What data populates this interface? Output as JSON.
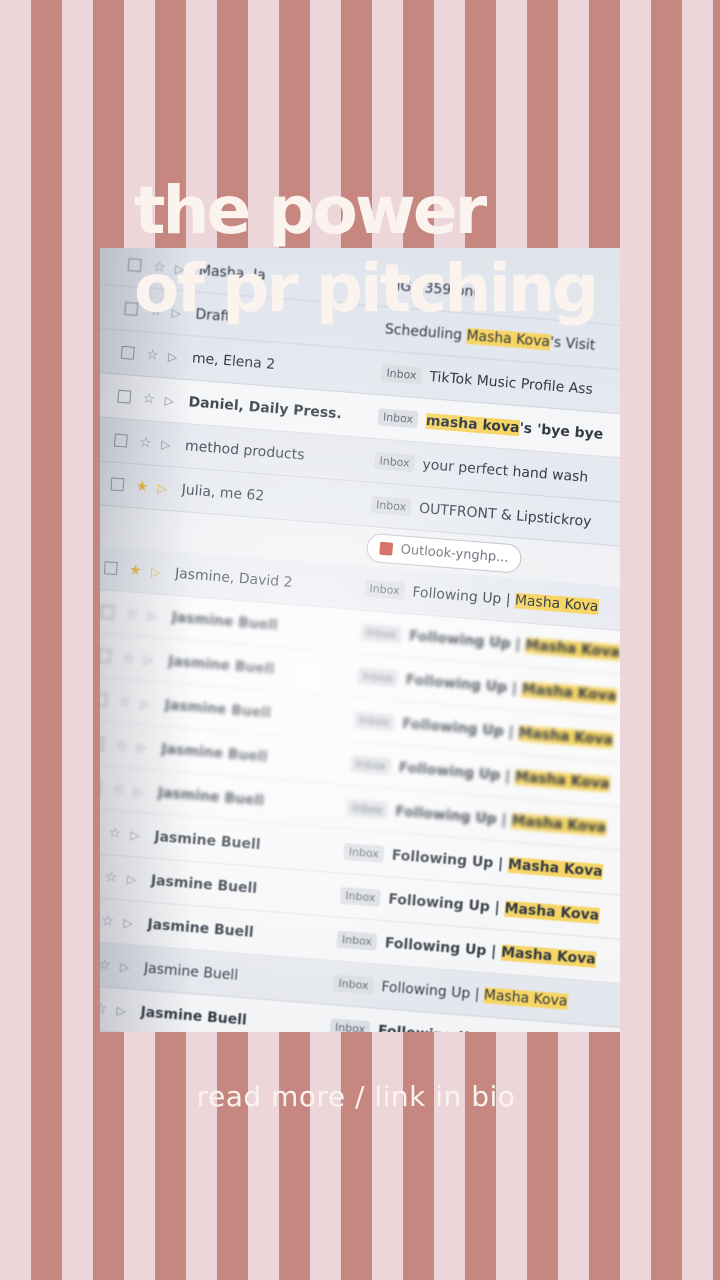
{
  "title": {
    "line1": "the power",
    "line2": "of pr pitching"
  },
  "footer_text": "read more / link in bio",
  "colors": {
    "stripe_light": "#ecd6d9",
    "stripe_dark": "#c58780",
    "title_text": "#fbf3ee",
    "highlight": "#f6d565"
  },
  "inbox": {
    "rows": [
      {
        "sender": "Masha, Ja",
        "tag": "",
        "subject": "MG 8359.png",
        "style": "read"
      },
      {
        "sender": "Draft",
        "tag": "",
        "subject_pre": "Scheduling ",
        "subject_hl": "Masha Kova",
        "subject_post": "'s Visit",
        "style": "read"
      },
      {
        "sender": "me, Elena 2",
        "tag": "Inbox",
        "subject": "TikTok Music Profile Ass",
        "style": "read"
      },
      {
        "sender": "Daniel, Daily Press.",
        "tag": "Inbox",
        "subject_hl": "masha kova",
        "subject_post": "'s 'bye bye",
        "style": "unread"
      },
      {
        "sender": "method products",
        "tag": "Inbox",
        "subject": "your perfect hand wash",
        "style": "read"
      },
      {
        "sender": "Julia, me 62",
        "tag": "Inbox",
        "subject": "OUTFRONT & Lipstickroy",
        "style": "read",
        "starred": true
      }
    ],
    "attachment_chip": "Outlook-ynghp...",
    "rows2": [
      {
        "sender": "Jasmine, David 2",
        "tag": "Inbox",
        "subject_pre": "Following Up | ",
        "subject_hl": "Masha Kova",
        "style": "read",
        "starred": true
      },
      {
        "sender": "Jasmine Buell",
        "tag": "Inbox",
        "subject_pre": "Following Up | ",
        "subject_hl": "Masha Kova",
        "style": "unread"
      },
      {
        "sender": "Jasmine Buell",
        "tag": "Inbox",
        "subject_pre": "Following Up | ",
        "subject_hl": "Masha Kova",
        "style": "unread"
      },
      {
        "sender": "Jasmine Buell",
        "tag": "Inbox",
        "subject_pre": "Following Up | ",
        "subject_hl": "Masha Kova",
        "style": "unread"
      },
      {
        "sender": "Jasmine Buell",
        "tag": "Inbox",
        "subject_pre": "Following Up | ",
        "subject_hl": "Masha Kova",
        "style": "unread"
      },
      {
        "sender": "Jasmine Buell",
        "tag": "Inbox",
        "subject_pre": "Following Up | ",
        "subject_hl": "Masha Kova",
        "style": "unread"
      },
      {
        "sender": "Jasmine Buell",
        "tag": "Inbox",
        "subject_pre": "Following Up | ",
        "subject_hl": "Masha Kova",
        "style": "unread"
      },
      {
        "sender": "Jasmine Buell",
        "tag": "Inbox",
        "subject_pre": "Following Up | ",
        "subject_hl": "Masha Kova",
        "style": "unread"
      },
      {
        "sender": "Jasmine Buell",
        "tag": "Inbox",
        "subject_pre": "Following Up | ",
        "subject_hl": "Masha Kova",
        "style": "unread"
      },
      {
        "sender": "Jasmine Buell",
        "tag": "Inbox",
        "subject_pre": "Following Up | ",
        "subject_hl": "Masha Kova",
        "style": "read"
      },
      {
        "sender": "Jasmine Buell",
        "tag": "Inbox",
        "subject_pre": "Following Up | ",
        "subject_hl": "Masha Kova",
        "style": "unread"
      },
      {
        "sender": "Jasmine Buell",
        "tag": "Inbox",
        "subject_pre": "Following Up | ",
        "subject_hl": "Masha Kova",
        "style": "unread"
      },
      {
        "sender": "",
        "tag": "Inbox",
        "subject_pre": "Following Up | ",
        "subject_hl": "",
        "style": "read"
      }
    ]
  }
}
